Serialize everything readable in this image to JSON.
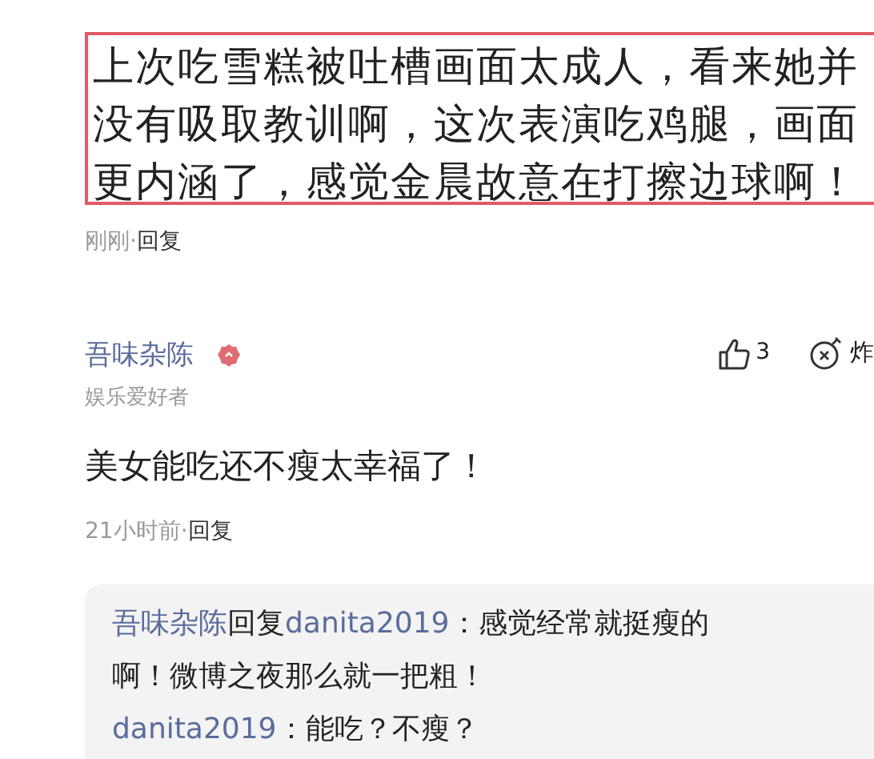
{
  "quoted_comment": {
    "text": "上次吃雪糕被吐槽画面太成人，看来她并没有吸取教训啊，这次表演吃鸡腿，画面更内涵了，感觉金晨故意在打擦边球啊！",
    "time": "刚刚·",
    "reply": "回复"
  },
  "comment": {
    "author": "吾味杂陈",
    "author_title": "娱乐爱好者",
    "likes": "3",
    "action": "炸",
    "text": "美女能吃还不瘦太幸福了！",
    "time": "21小时前·",
    "reply": "回复",
    "replies": [
      {
        "author": "吾味杂陈",
        "verb": "回复",
        "target": "danita2019",
        "text": "：感觉经常就挺瘦的啊！微博之夜那么就一把粗！"
      },
      {
        "author": "danita2019",
        "text": "：能吃？不瘦？"
      }
    ]
  }
}
